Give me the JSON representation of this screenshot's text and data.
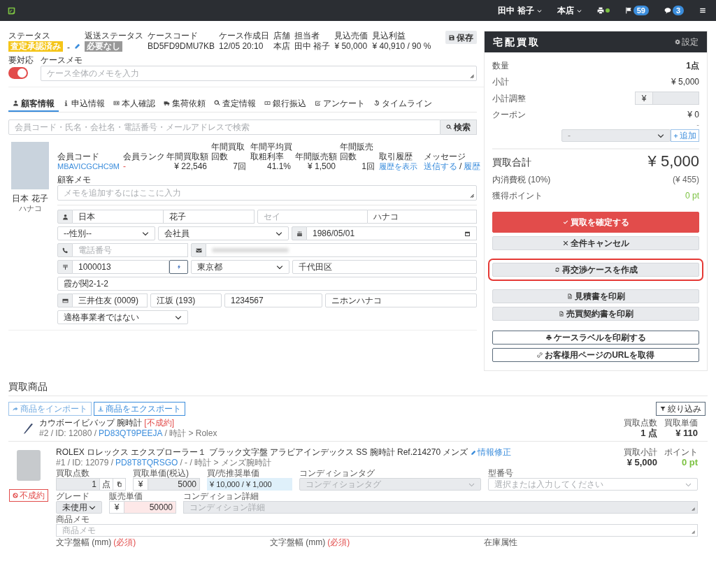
{
  "topbar": {
    "user": "田中 裕子",
    "store": "本店",
    "printer_online": true,
    "flag_count": "59",
    "message_count": "3"
  },
  "case_header": {
    "status": {
      "label": "ステータス",
      "badge": "査定承認済み"
    },
    "separator": "-",
    "return_status": {
      "label": "返送ステータス",
      "badge": "必要なし"
    },
    "fields": [
      {
        "label": "ケースコード",
        "value": "BD5FD9DMU7KB"
      },
      {
        "label": "ケース作成日",
        "value": "12/05 20:10"
      },
      {
        "label": "店舗",
        "value": "本店"
      },
      {
        "label": "担当者",
        "value": "田中 裕子"
      },
      {
        "label": "見込売価",
        "value": "¥ 50,000"
      },
      {
        "label": "見込利益",
        "value": "¥ 40,910 / 90 %"
      }
    ],
    "save_button": "保存",
    "needs_action": {
      "label": "要対応",
      "on": true
    },
    "memo": {
      "label": "ケースメモ",
      "placeholder": "ケース全体のメモを入力"
    }
  },
  "tabs": [
    {
      "label": "顧客情報",
      "selected": true
    },
    {
      "label": "申込情報",
      "selected": false
    },
    {
      "label": "本人確認",
      "selected": false
    },
    {
      "label": "集荷依頼",
      "selected": false
    },
    {
      "label": "査定情報",
      "selected": false
    },
    {
      "label": "銀行振込",
      "selected": false
    },
    {
      "label": "アンケート",
      "selected": false
    },
    {
      "label": "タイムライン",
      "selected": false
    }
  ],
  "search": {
    "placeholder": "会員コード・氏名・会社名・電話番号・メールアドレスで検索",
    "button": "検索"
  },
  "customer": {
    "name": "日本 花子",
    "kana": "ハナコ",
    "stats": [
      {
        "label": "会員コード",
        "value": "MBAVICGCHC9M",
        "kind": "link"
      },
      {
        "label": "会員ランク",
        "value": "-",
        "kind": "alert"
      },
      {
        "label": "年間買取額",
        "value": "¥ 22,546",
        "kind": "number"
      },
      {
        "label": "年間買取回数",
        "value": "7回",
        "kind": "number"
      },
      {
        "label": "年間平均買取粗利率",
        "value": "41.1%",
        "kind": "number"
      },
      {
        "label": "年間販売額",
        "value": "¥ 1,500",
        "kind": "number"
      },
      {
        "label": "年間販売回数",
        "value": "1回",
        "kind": "number"
      },
      {
        "label": "取引履歴",
        "value": "履歴を表示",
        "kind": "link"
      },
      {
        "label": "メッセージ",
        "links": [
          "送信する",
          "履歴"
        ],
        "separator": "/",
        "kind": "links"
      }
    ],
    "memo": {
      "label": "顧客メモ",
      "placeholder": "メモを追加するにはここに入力"
    },
    "last_name": "日本",
    "first_name": "花子",
    "kana_last_placeholder": "セイ",
    "kana_first": "ハナコ",
    "gender": "--性別--",
    "occupation": "会社員",
    "birthday": "1986/05/01",
    "phone_placeholder": "電話番号",
    "zip": "1000013",
    "prefecture": "東京都",
    "city": "千代田区",
    "address": "霞が関2-1-2",
    "bank": "三井住友 (0009)",
    "branch": "江坂 (193)",
    "account": "1234567",
    "holder": "ニホンハナコ",
    "invoice": "適格事業者ではない"
  },
  "summary": {
    "title": "宅配買取",
    "settings": "設定",
    "quantity": {
      "label": "数量",
      "value": "1点"
    },
    "subtotal": {
      "label": "小計",
      "value": "¥ 5,000"
    },
    "adjustment": {
      "label": "小計調整",
      "prefix": "¥"
    },
    "coupon": {
      "label": "クーポン",
      "value": "¥ 0",
      "note": "-",
      "select": "-",
      "add_button": "追加"
    },
    "total": {
      "label": "買取合計",
      "value": "¥ 5,000"
    },
    "tax": {
      "label": "内消費税 (10%)",
      "value": "(¥ 455)"
    },
    "points": {
      "label": "獲得ポイント",
      "value": "0 pt"
    },
    "action_groups": [
      [
        {
          "label": "買取を確定する",
          "kind": "danger",
          "highlighted": false
        },
        {
          "label": "全件キャンセル",
          "kind": "muted",
          "highlighted": false
        }
      ],
      [
        {
          "label": "再交渉ケースを作成",
          "kind": "muted",
          "highlighted": true
        }
      ],
      [
        {
          "label": "見積書を印刷",
          "kind": "muted",
          "highlighted": false
        },
        {
          "label": "売買契約書を印刷",
          "kind": "muted",
          "highlighted": false
        }
      ],
      [
        {
          "label": "ケースラベルを印刷する",
          "kind": "outline",
          "highlighted": false
        },
        {
          "label": "お客様用ページのURLを取得",
          "kind": "outline",
          "highlighted": false
        }
      ]
    ]
  },
  "products": {
    "title": "買取商品",
    "import_button": "商品をインポート",
    "export_button": "商品をエクスポート",
    "filter_button": "絞り込み",
    "items": [
      {
        "kind": "compact",
        "name": "カウボーイビバップ 腕時計",
        "tag": "[不成約]",
        "meta_prefix": "#2 / ID: 12080 /",
        "code": "PD83QT9PEEJA",
        "meta_suffix": "/ 時計 > Rolex",
        "stats": [
          {
            "label": "買取点数",
            "value": "1 点",
            "color": "#333333"
          },
          {
            "label": "買取単価",
            "value": "¥ 110",
            "color": "#333333"
          }
        ]
      },
      {
        "kind": "detailed",
        "name": "ROLEX ロレックス エクスプローラー１ ブラック文字盤 アラビアインデックス SS 腕時計 Ref.214270 メンズ",
        "edit_link": "情報修正",
        "meta_prefix": "#1 / ID: 12079 /",
        "code": "PD8T8TQRSGO",
        "meta_suffix": "/ - / 時計 > メンズ腕時計",
        "stats": [
          {
            "label": "買取小計",
            "value": "¥ 5,000",
            "color": "#333333"
          },
          {
            "label": "ポイント",
            "value": "0 pt",
            "color": "#7cc242"
          }
        ],
        "status_badge": "不成約",
        "quantity": {
          "label": "買取点数",
          "value": "1",
          "unit": "点"
        },
        "unit_price": {
          "label": "買取単価(税込)",
          "prefix": "¥",
          "value": "5000"
        },
        "recommended": {
          "label": "買/売推奨単価",
          "value": "¥ 10,000 / ¥ 1,000"
        },
        "condition_tag": {
          "label": "コンディションタグ",
          "placeholder": "コンディションタグ"
        },
        "model_number": {
          "label": "型番号",
          "placeholder": "選択または入力してください"
        },
        "grade": {
          "label": "グレード",
          "value": "未使用"
        },
        "sale_price": {
          "label": "販売単価",
          "prefix": "¥",
          "value": "50000"
        },
        "condition_detail": {
          "label": "コンディション詳細",
          "placeholder": "コンディション詳細"
        },
        "memo": {
          "label": "商品メモ",
          "placeholder": "商品メモ"
        },
        "cut_labels": [
          {
            "label": "文字盤幅 (mm)",
            "required": "(必須)"
          },
          {
            "label": "文字盤幅 (mm)",
            "required": "(必須)"
          },
          {
            "label": "在庫属性"
          }
        ]
      }
    ]
  }
}
